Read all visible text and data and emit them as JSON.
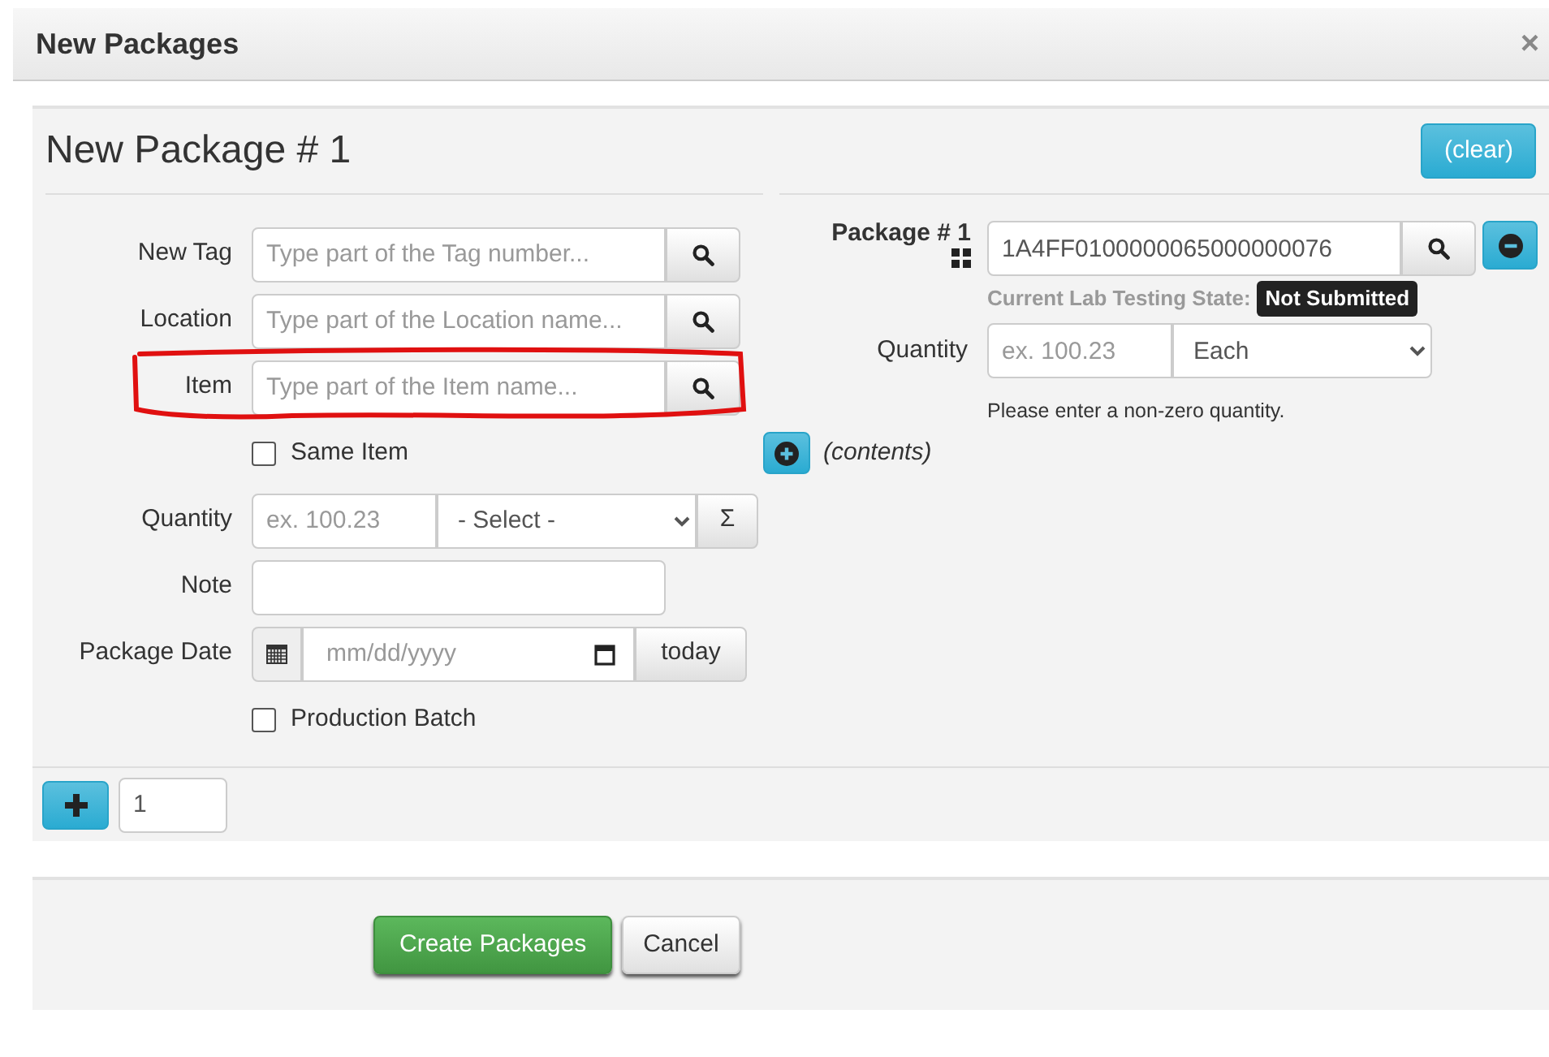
{
  "dialog": {
    "title": "New Packages",
    "close": "×"
  },
  "panel": {
    "heading": "New Package # 1",
    "clear_button": "(clear)",
    "fields": [
      {
        "kind": "search",
        "label": "New Tag",
        "placeholder": "Type part of the Tag number..."
      },
      {
        "kind": "search",
        "label": "Location",
        "placeholder": "Type part of the Location name..."
      },
      {
        "kind": "search",
        "label": "Item",
        "placeholder": "Type part of the Item name...",
        "highlighted": true
      },
      {
        "kind": "checkbox",
        "label": "Same Item",
        "checked": false
      },
      {
        "kind": "quantity",
        "label": "Quantity",
        "placeholder": "ex. 100.23",
        "unit": "- Select -",
        "sum_button": "Σ"
      },
      {
        "kind": "text",
        "label": "Note"
      },
      {
        "kind": "date",
        "label": "Package Date",
        "placeholder": "mm/dd/yyyy",
        "today_button": "today"
      },
      {
        "kind": "checkbox",
        "label": "Production Batch",
        "checked": false
      }
    ],
    "source": {
      "label": "Package # 1",
      "tag_value": "1A4FF0100000065000000076",
      "lab_state_label": "Current Lab Testing State:",
      "lab_state": "Not Submitted",
      "quantity_label": "Quantity",
      "quantity_placeholder": "ex. 100.23",
      "unit": "Each",
      "quantity_hint": "Please enter a non-zero quantity.",
      "contents_label": "(contents)"
    },
    "count": "1"
  },
  "buttons": [
    {
      "label": "Create Packages",
      "kind": "primary"
    },
    {
      "label": "Cancel",
      "kind": "default"
    }
  ]
}
